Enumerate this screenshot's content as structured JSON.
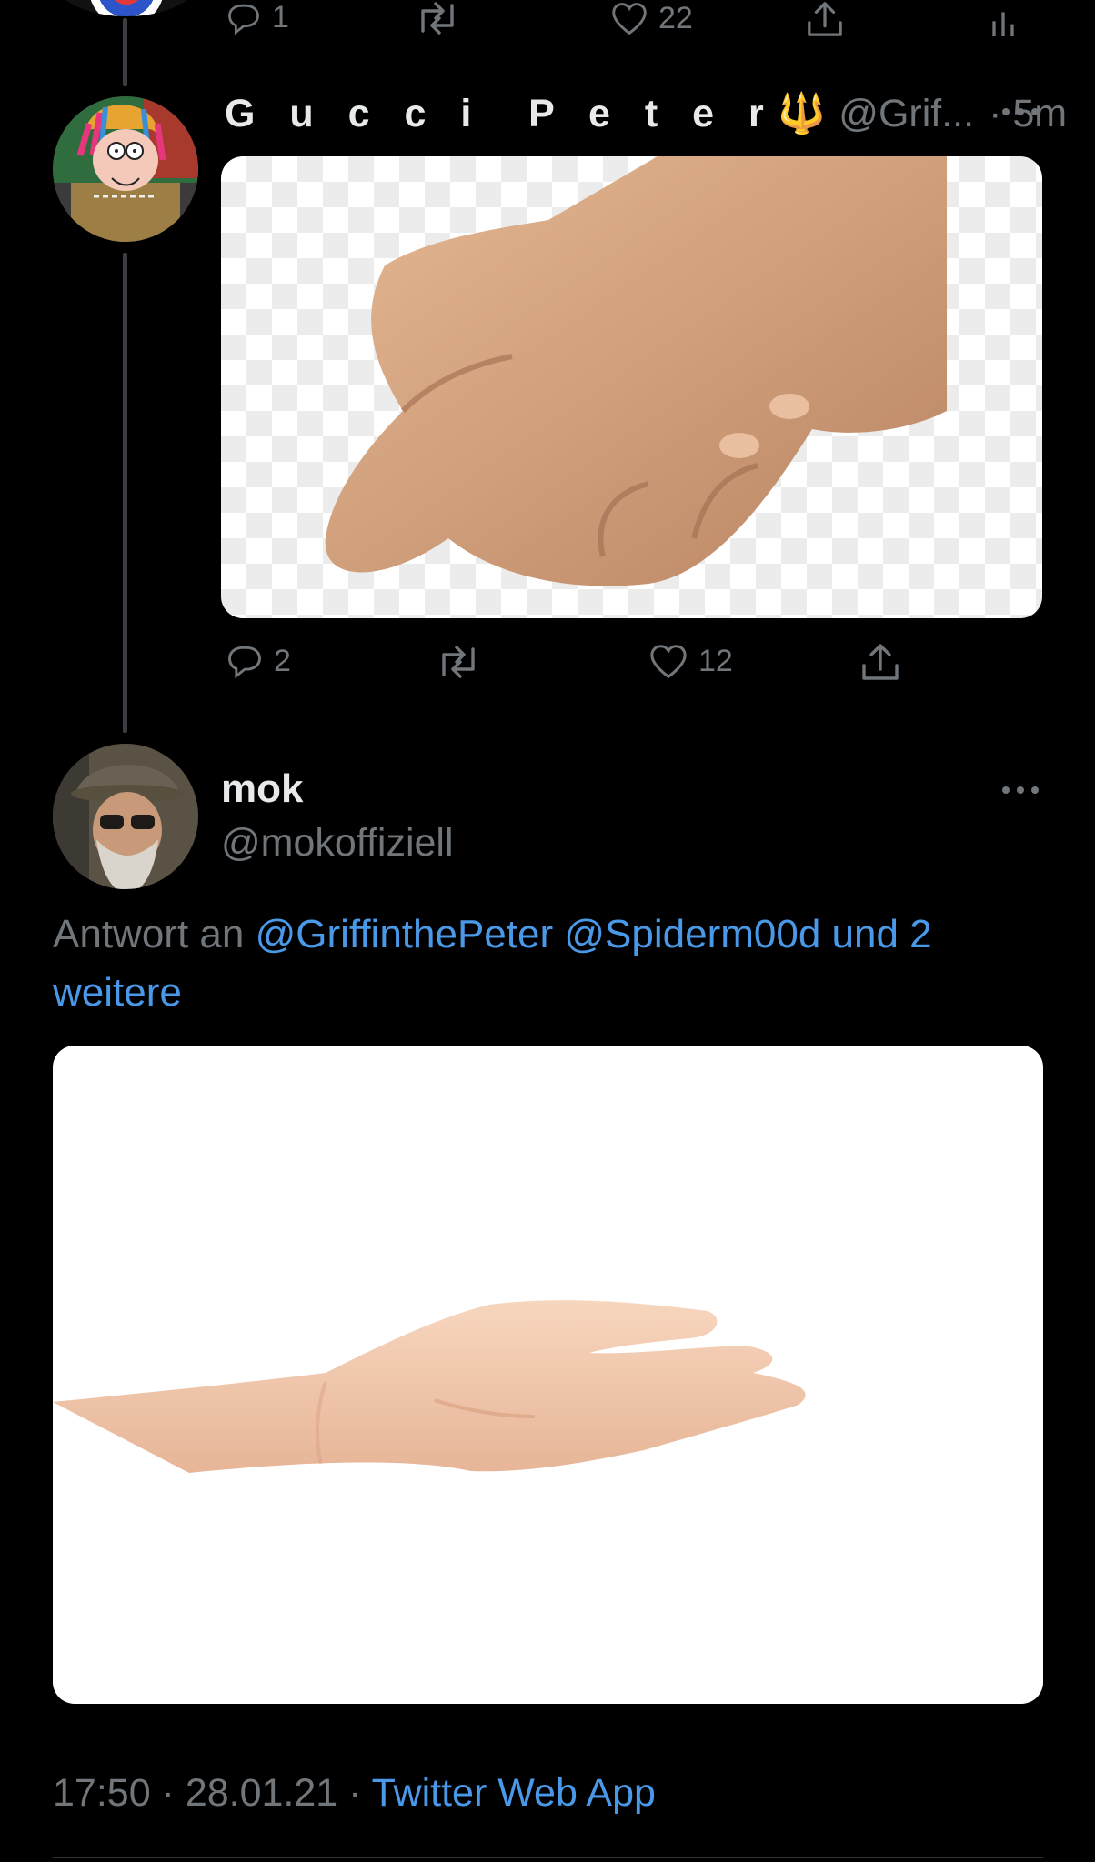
{
  "top_tweet": {
    "reply_count": "1",
    "like_count": "22"
  },
  "gucci_tweet": {
    "display_name": "G u c c i  P e t e r",
    "name_emoji": "🔱",
    "handle": "@Grif...",
    "time": "· 5m",
    "reply_count": "2",
    "like_count": "12",
    "image": "hand-reaching-transparent-background"
  },
  "mok_tweet": {
    "display_name": "mok",
    "handle": "@mokoffiziell",
    "reply_prefix": "Antwort an",
    "reply_to_1": "@GriffinthePeter",
    "reply_to_2": "@Spiderm00d",
    "reply_more": "und 2",
    "reply_more_2": "weitere",
    "image": "open-palm-hand-white-background",
    "timestamp": "17:50 · 28.01.21 ·",
    "source": "Twitter Web App"
  },
  "colors": {
    "background": "#000000",
    "text": "#e7e9ea",
    "muted": "#71767b",
    "link": "#4a99e9",
    "thread_line": "#3a3d41"
  }
}
